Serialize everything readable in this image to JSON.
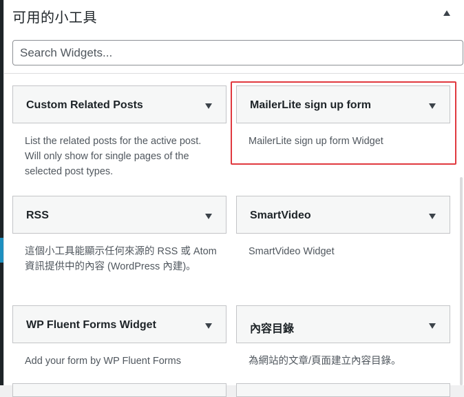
{
  "panel": {
    "title": "可用的小工具"
  },
  "search": {
    "placeholder": "Search Widgets..."
  },
  "widgets": [
    {
      "title": "Custom Related Posts",
      "description": "List the related posts for the active post. Will only show for single pages of the selected post types."
    },
    {
      "title": "MailerLite sign up form",
      "description": "MailerLite sign up form Widget"
    },
    {
      "title": "RSS",
      "description": "這個小工具能顯示任何來源的 RSS 或 Atom 資訊提供中的內容 (WordPress 內建)。"
    },
    {
      "title": "SmartVideo",
      "description": "SmartVideo Widget"
    },
    {
      "title": "WP Fluent Forms Widget",
      "description": "Add your form by WP Fluent Forms"
    },
    {
      "title": "內容目錄",
      "description": "為網站的文章/頁面建立內容目錄。"
    }
  ],
  "colors": {
    "highlight": "#e0383e",
    "accent": "#1e8fbf"
  }
}
